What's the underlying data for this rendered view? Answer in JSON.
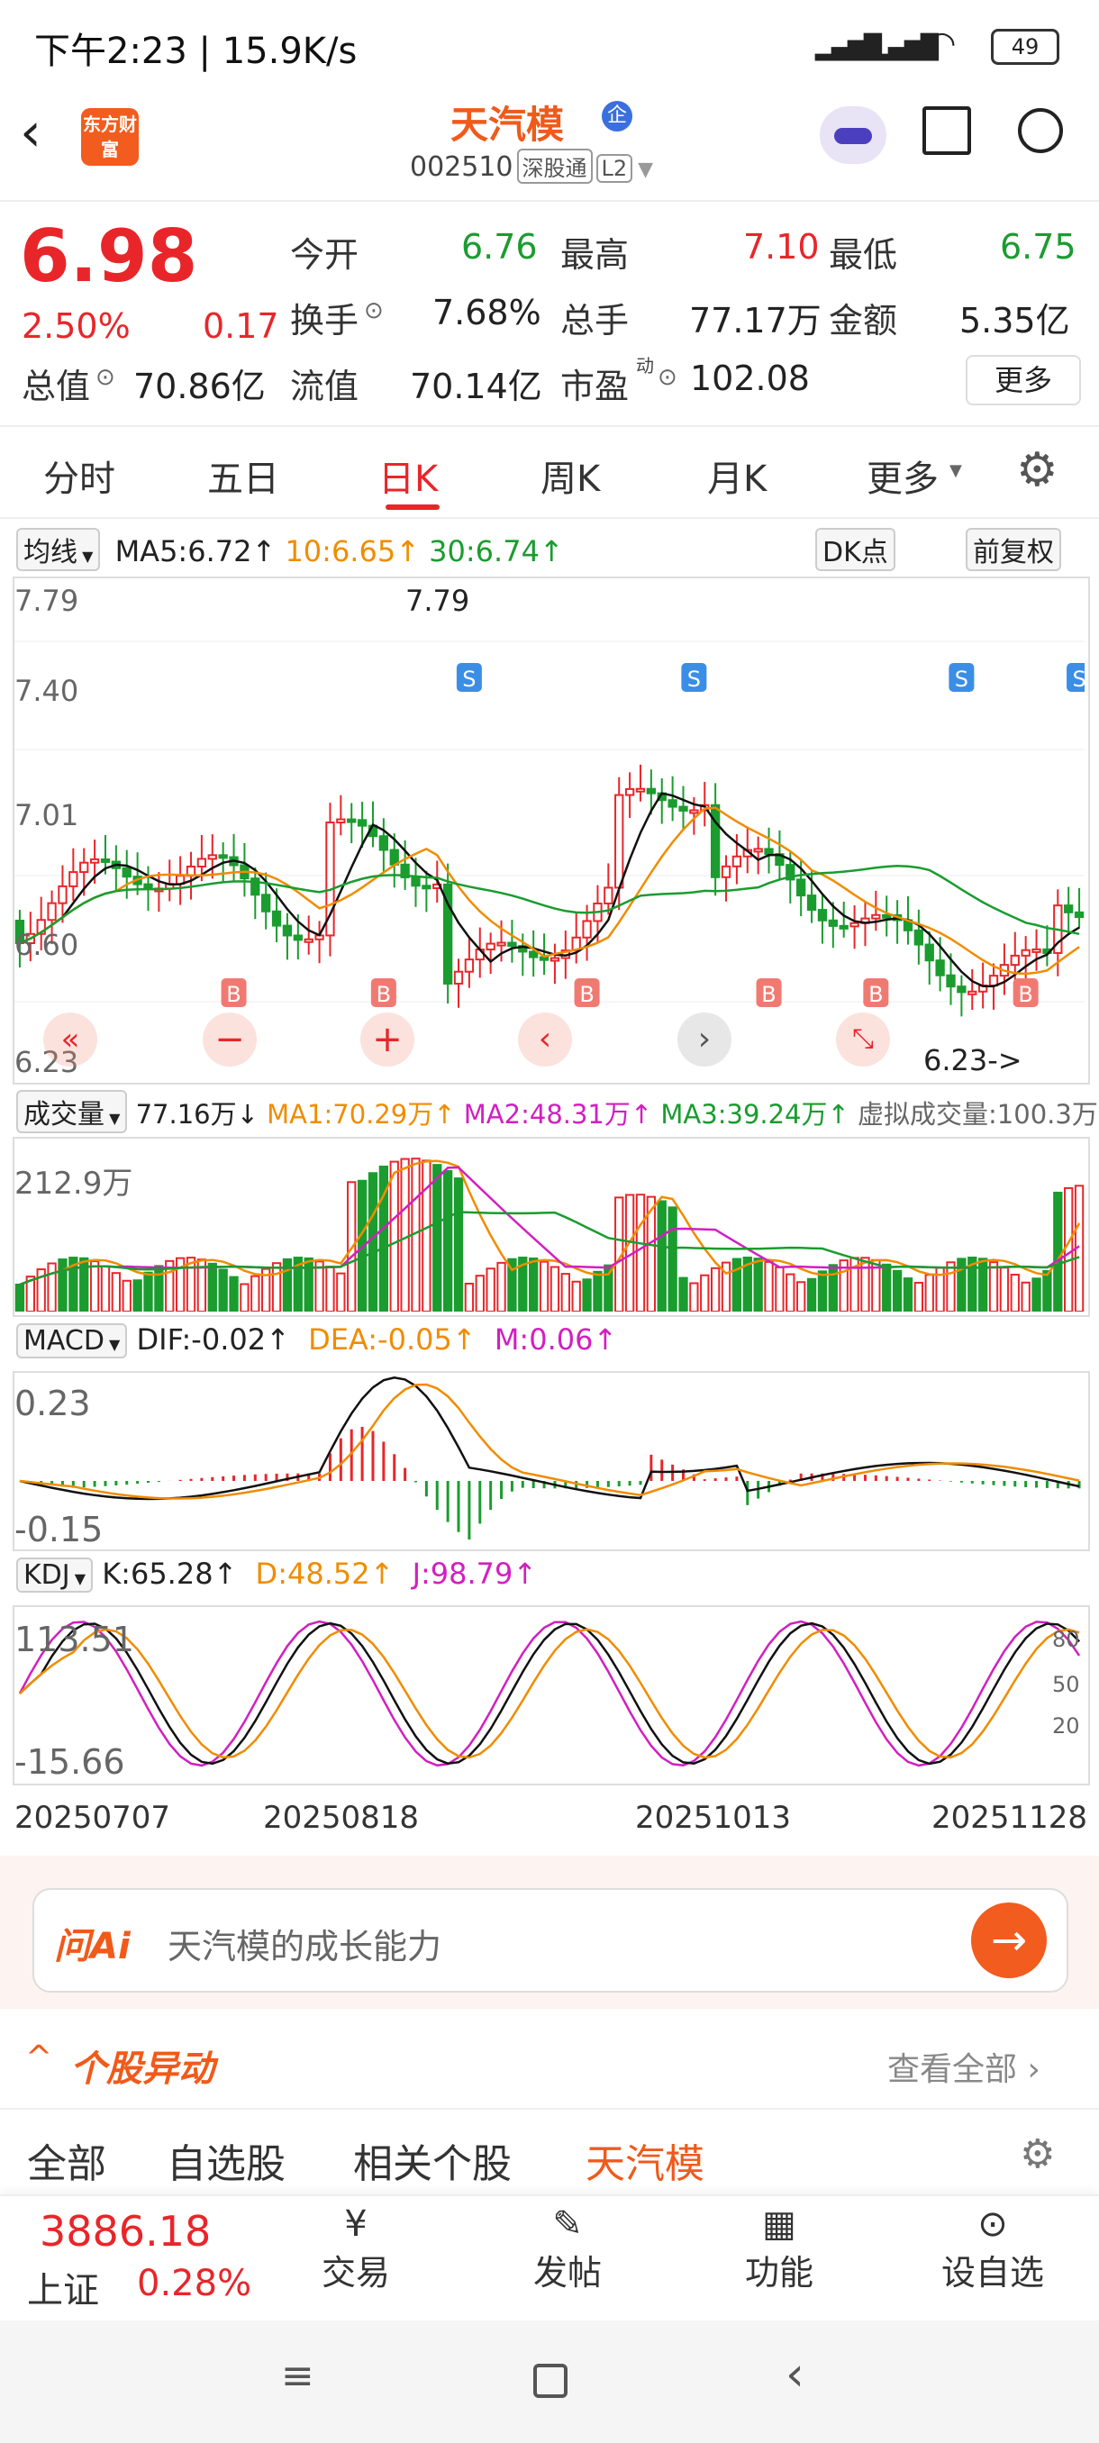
{
  "status_bar": {
    "time": "下午2:23 | 15.9K/s",
    "battery": "49"
  },
  "header": {
    "logo_text": "东方财富",
    "stock_name": "天汽模",
    "enterprise_badge": "企",
    "stock_code": "002510",
    "tags": [
      "深股通",
      "L2"
    ]
  },
  "quote": {
    "price": "6.98",
    "change_pct": "2.50%",
    "change": "0.17",
    "fields": [
      {
        "label": "今开",
        "value": "6.76"
      },
      {
        "label": "最高",
        "value": "7.10"
      },
      {
        "label": "最低",
        "value": "6.75"
      },
      {
        "label": "换手",
        "value": "7.68%"
      },
      {
        "label": "总手",
        "value": "77.17万"
      },
      {
        "label": "金额",
        "value": "5.35亿"
      },
      {
        "label": "总值",
        "value": "70.86亿"
      },
      {
        "label": "流值",
        "value": "70.14亿"
      },
      {
        "label": "市盈",
        "value": "102.08"
      }
    ],
    "pe_sup": "动",
    "more": "更多"
  },
  "tabs": [
    "分时",
    "五日",
    "日K",
    "周K",
    "月K",
    "更多"
  ],
  "active_tab": "日K",
  "kline": {
    "ma_select": "均线",
    "ma5": "MA5:6.72↑",
    "ma10": "10:6.65↑",
    "ma30": "30:6.74↑",
    "dk_button": "DK点",
    "adjust_button": "前复权",
    "y_labels": [
      "7.79",
      "7.40",
      "7.01",
      "6.60",
      "6.23"
    ],
    "high_label": "7.79",
    "low_label": "6.23->"
  },
  "volume": {
    "select": "成交量",
    "vol": "77.16万↓",
    "ma1": "MA1:70.29万↑",
    "ma2": "MA2:48.31万↑",
    "ma3": "MA3:39.24万↑",
    "virtual": "虚拟成交量:100.3万",
    "y_label": "212.9万"
  },
  "macd": {
    "select": "MACD",
    "dif": "DIF:-0.02↑",
    "dea": "DEA:-0.05↑",
    "m": "M:0.06↑",
    "y_top": "0.23",
    "y_bottom": "-0.15"
  },
  "kdj": {
    "select": "KDJ",
    "k": "K:65.28↑",
    "d": "D:48.52↑",
    "j": "J:98.79↑",
    "y_top": "113.51",
    "y_bottom": "-15.66",
    "right_80": "80",
    "right_50": "50",
    "right_20": "20"
  },
  "dates": [
    "20250707",
    "20250818",
    "20251013",
    "20251128"
  ],
  "ai": {
    "logo": "问Ai",
    "placeholder": "天汽模的成长能力"
  },
  "movement": {
    "title": "个股异动",
    "view_all": "查看全部"
  },
  "filter_tabs": [
    "全部",
    "自选股",
    "相关个股",
    "天汽模"
  ],
  "active_filter": "天汽模",
  "bottom_bar": {
    "index_value": "3886.18",
    "index_name": "上证",
    "index_change": "0.28%",
    "items": [
      "交易",
      "发帖",
      "功能",
      "设自选"
    ]
  },
  "colors": {
    "up": "#e8262a",
    "down": "#1a9c2f",
    "accent": "#f05a1a",
    "ma10": "#f08c00",
    "j": "#d21fc2"
  }
}
